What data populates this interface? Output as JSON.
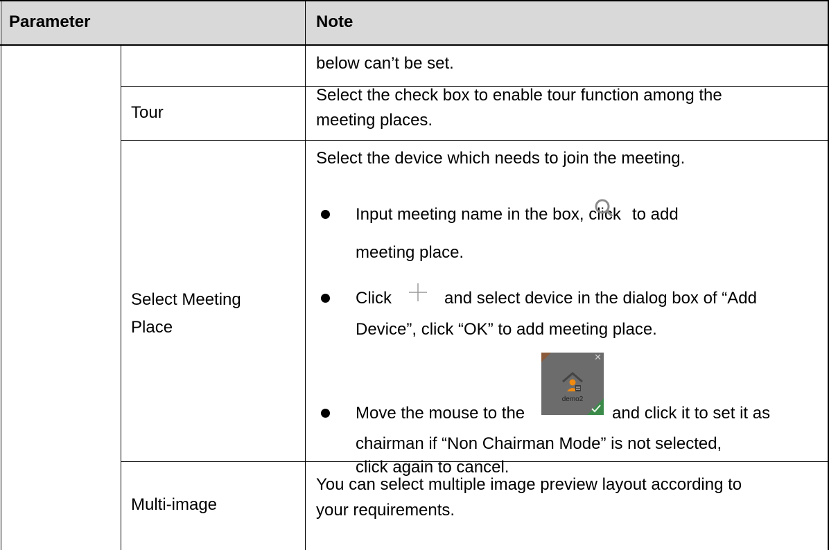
{
  "header": {
    "parameter": "Parameter",
    "note": "Note"
  },
  "rows": {
    "row0": {
      "note": "below can’t be set."
    },
    "tour": {
      "label": "Tour",
      "note_line1": "Select the check box to enable tour function among the",
      "note_line2": "meeting places."
    },
    "select_meeting_place": {
      "label_line1": "Select Meeting",
      "label_line2": "Place",
      "intro": "Select the device which needs to join the meeting.",
      "bullet1_line1a": "Input meeting name in the box, click",
      "bullet1_line1b": "to add",
      "bullet1_line2": "meeting place.",
      "bullet2_line1a": "Click",
      "bullet2_line1b": "and select device in the dialog box of “Add",
      "bullet2_line2": "Device”, click “OK” to add meeting place.",
      "bullet3_line1a": "Move the mouse to the",
      "bullet3_line1b": "and click it to set it as",
      "bullet3_line2": "chairman if “Non Chairman Mode” is not selected,",
      "bullet3_line3": "click again to cancel.",
      "thumbnail_caption": "demo2"
    },
    "multi_image": {
      "label": "Multi-image",
      "note_line1": "You can select multiple image preview layout according to",
      "note_line2": "your requirements."
    }
  },
  "icons": {
    "search": "search-icon",
    "plus": "plus-icon",
    "house_user": "house-user-icon",
    "close": "close-icon",
    "check": "check-icon"
  },
  "colors": {
    "header_bg": "#d9d9d9",
    "thumbnail_bg": "#6c6c6c",
    "search_icon": "#8a8a8a",
    "plus_icon": "#9a9a9a",
    "check_icon": "#3f9b3f",
    "user_icon": "#f08a10"
  }
}
